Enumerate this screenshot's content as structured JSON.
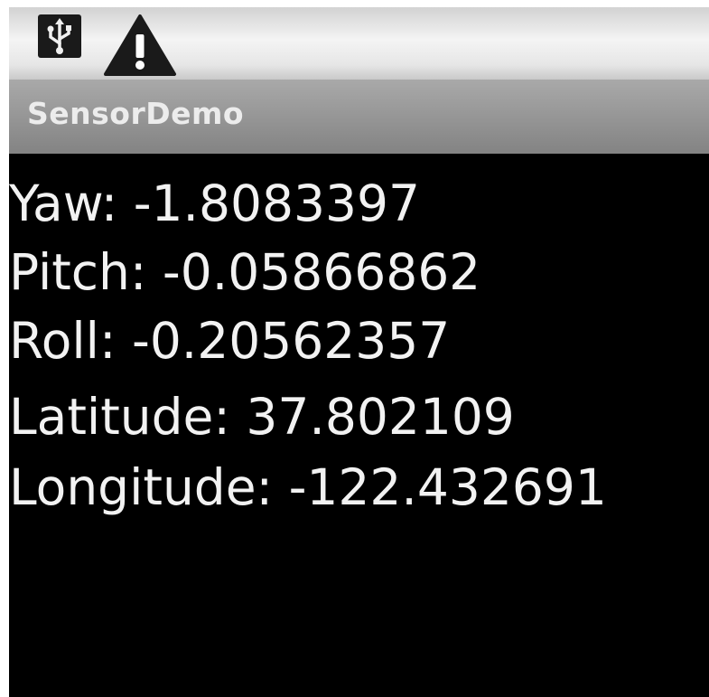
{
  "status_bar": {
    "icons": [
      "usb-icon",
      "warning-icon"
    ]
  },
  "app": {
    "title": "SensorDemo"
  },
  "readings": {
    "yaw": "Yaw: -1.8083397",
    "pitch": "Pitch: -0.05866862",
    "roll": "Roll: -0.20562357",
    "latitude": "Latitude: 37.802109",
    "longitude": "Longitude: -122.432691"
  },
  "colors": {
    "background": "#000000",
    "text": "#f2f2f2",
    "title_bar": "#9a9a9a",
    "status_bar": "#e6e6e6"
  }
}
